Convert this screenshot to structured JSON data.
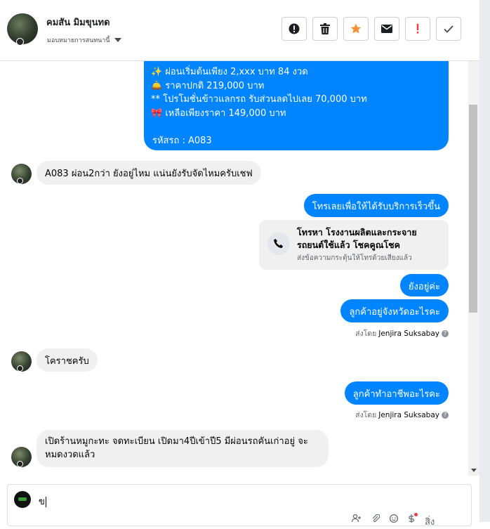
{
  "header": {
    "name": "คมสัน มิมขุนทด",
    "assign_label": "มอบหมายการสนทนานี้"
  },
  "actions": [
    {
      "icon": "alert-circle-icon",
      "color": "#1c1e21"
    },
    {
      "icon": "trash-icon",
      "color": "#1c1e21"
    },
    {
      "icon": "star-icon",
      "color": "#f7923b"
    },
    {
      "icon": "mail-icon",
      "color": "#1c1e21"
    },
    {
      "icon": "exclamation-icon",
      "color": "#fa383e"
    },
    {
      "icon": "check-icon",
      "color": "#1c1e21"
    }
  ],
  "messages": {
    "promo_lines": [
      "✨  ผ่อนเริ่มต้นเพียง 2,xxx บาท 84 งวด",
      "🛎️ ราคาปกติ 219,000 บาท",
      "** โปรโมชั่นข้าวแลกรถ รับส่วนลดไปเลย 70,000 บาท",
      "🎀  เหลือเพียงราคา 149,000 บาท",
      "รหัสรถ : A083"
    ],
    "in_1": "A083  ผ่อน2กว่า ยังอยู่ไหม แน่นยังรับจัดไหมครับเชฟ",
    "out_1": "โทรเลยเพื่อให้ได้รับบริการเร็วขึ้น",
    "call_title": "โทรหา โรงงานผลิตและกระจายรถยนต์ใช้แล้ว โชคคูณโชค",
    "call_sub": "ส่งข้อความกระตุ้นให้โทรด้วยเสียงแล้ว",
    "out_2": "ยังอยู่ค่ะ",
    "out_3": "ลูกค้าอยู่จังหวัดอะไรคะ",
    "sent_by_label": "ส่งโดย",
    "sent_by_name": "Jenjira Suksabay",
    "in_2": "โคราชครับ",
    "out_4": "ลูกค้าทำอาชีพอะไรคะ",
    "in_3_line1": "เปิดร้านหมูกะทะ จดทะเบียน เปิดมา4ปีเข้าปี5 มีผ่อนรถคันเก่าอยู่ จะ",
    "in_3_line2": "หมดงวดแล้ว"
  },
  "composer": {
    "value": "ข",
    "tools": [
      "add-person-icon",
      "attach-icon",
      "emoji-icon",
      "money-icon",
      "more-icon"
    ],
    "more_label": "สิ่ง"
  },
  "colors": {
    "outgoing": "#0084ff",
    "incoming": "#f0f0f0",
    "star": "#f7923b",
    "flag": "#fa383e"
  }
}
